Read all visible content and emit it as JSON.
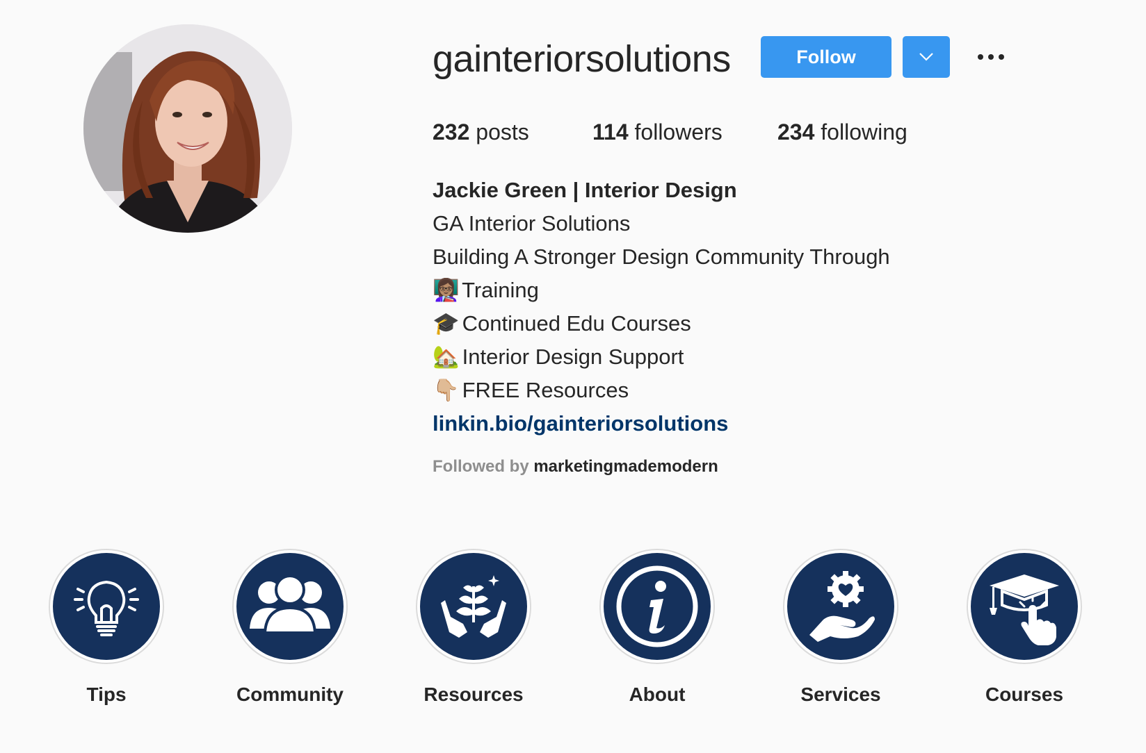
{
  "profile": {
    "username": "gainteriorsolutions",
    "follow_label": "Follow",
    "stats": {
      "posts_count": "232",
      "posts_label": "posts",
      "followers_count": "114",
      "followers_label": "followers",
      "following_count": "234",
      "following_label": "following"
    },
    "bio": {
      "name": "Jackie Green | Interior Design",
      "line1": "GA Interior Solutions",
      "line2": "Building A Stronger Design Community Through",
      "item1_emoji": "👩🏽‍🏫",
      "item1": "Training",
      "item2_emoji": "🎓",
      "item2": "Continued Edu Courses",
      "item3_emoji": "🏡",
      "item3": "Interior Design Support",
      "item4_emoji": "👇🏼",
      "item4": "FREE Resources",
      "link": "linkin.bio/gainteriorsolutions"
    },
    "followed_by_prefix": "Followed by",
    "followed_by_user": "marketingmademodern"
  },
  "highlights": [
    {
      "label": "Tips",
      "icon": "lightbulb-icon"
    },
    {
      "label": "Community",
      "icon": "group-icon"
    },
    {
      "label": "Resources",
      "icon": "hands-plant-icon"
    },
    {
      "label": "About",
      "icon": "info-icon"
    },
    {
      "label": "Services",
      "icon": "hand-heart-gear-icon"
    },
    {
      "label": "Courses",
      "icon": "graduation-cap-pointer-icon"
    }
  ],
  "colors": {
    "accent": "#3897f0",
    "highlight_fill": "#15315c",
    "link": "#003569",
    "background": "#fafafa"
  }
}
